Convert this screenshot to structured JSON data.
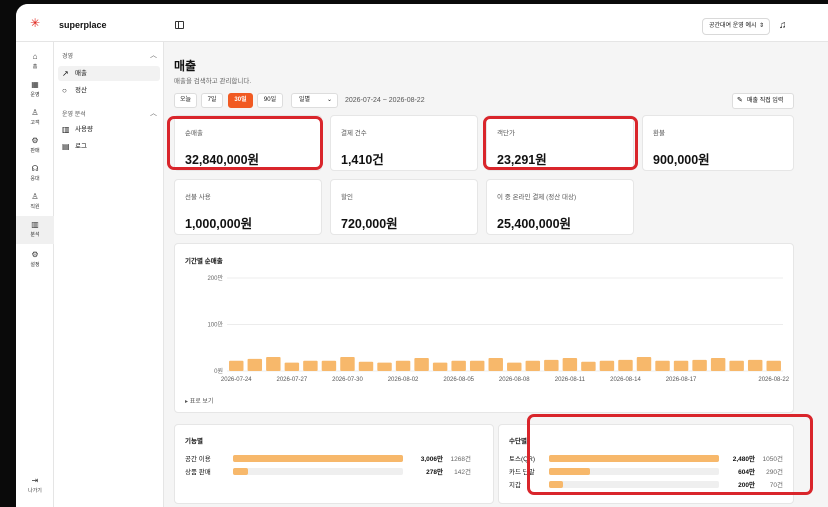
{
  "app": {
    "brand": "superplace",
    "store_select": "공간대여 운영 예시"
  },
  "rail": [
    {
      "icon": "home-icon",
      "glyph": "⌂",
      "label": "홈"
    },
    {
      "icon": "calendar-icon",
      "glyph": "▦",
      "label": "운영"
    },
    {
      "icon": "user-icon",
      "glyph": "♙",
      "label": "고객"
    },
    {
      "icon": "sales-icon",
      "glyph": "⚙",
      "label": "판매"
    },
    {
      "icon": "headset-icon",
      "glyph": "☊",
      "label": "응대"
    },
    {
      "icon": "staff-icon",
      "glyph": "♙",
      "label": "직원"
    },
    {
      "icon": "analytics-icon",
      "glyph": "▥",
      "label": "분석"
    },
    {
      "icon": "settings-icon",
      "glyph": "⚙",
      "label": "설정"
    },
    {
      "icon": "logout-icon",
      "glyph": "⇥",
      "label": "나가기"
    }
  ],
  "subnav": {
    "section1": "경영",
    "items1": [
      {
        "label": "매출",
        "glyph": "↗"
      },
      {
        "label": "정산",
        "glyph": "○"
      }
    ],
    "section2": "운영 분석",
    "items2": [
      {
        "label": "사용량",
        "glyph": "▥"
      },
      {
        "label": "로그",
        "glyph": "▤"
      }
    ]
  },
  "page": {
    "title": "매출",
    "subtitle": "매출을 검색하고 관리합니다."
  },
  "filters": {
    "ranges": [
      "오늘",
      "7일",
      "30일",
      "90일"
    ],
    "active_range": "30일",
    "period": "일별",
    "daterange": "2026-07-24 ~ 2026-08-22",
    "manual_button": "매출 직접 입력"
  },
  "kpis": [
    {
      "label": "순매출",
      "value": "32,840,000원"
    },
    {
      "label": "결제 건수",
      "value": "1,410건"
    },
    {
      "label": "객단가",
      "value": "23,291원"
    },
    {
      "label": "환불",
      "value": "900,000원"
    },
    {
      "label": "선불 사용",
      "value": "1,000,000원"
    },
    {
      "label": "할인",
      "value": "720,000원"
    },
    {
      "label": "이 중 온라인 결제 (정산 대상)",
      "value": "25,400,000원"
    }
  ],
  "chart_data": {
    "type": "bar",
    "title": "기간별 순매출",
    "y_ticks": [
      "200만",
      "100만",
      "0원"
    ],
    "ylim": [
      0,
      200
    ],
    "x": [
      "2026-07-24",
      "2026-07-25",
      "2026-07-26",
      "2026-07-27",
      "2026-07-28",
      "2026-07-29",
      "2026-07-30",
      "2026-07-31",
      "2026-08-01",
      "2026-08-02",
      "2026-08-03",
      "2026-08-04",
      "2026-08-05",
      "2026-08-06",
      "2026-08-07",
      "2026-08-08",
      "2026-08-09",
      "2026-08-10",
      "2026-08-11",
      "2026-08-12",
      "2026-08-13",
      "2026-08-14",
      "2026-08-15",
      "2026-08-16",
      "2026-08-17",
      "2026-08-18",
      "2026-08-19",
      "2026-08-20",
      "2026-08-21",
      "2026-08-22"
    ],
    "x_tick_labels": [
      "2026-07-24",
      "2026-07-27",
      "2026-07-30",
      "2026-08-02",
      "2026-08-05",
      "2026-08-08",
      "2026-08-11",
      "2026-08-14",
      "2026-08-17",
      "2026-08-22"
    ],
    "values": [
      22,
      26,
      30,
      18,
      22,
      22,
      30,
      20,
      18,
      22,
      28,
      18,
      22,
      22,
      28,
      18,
      22,
      24,
      28,
      20,
      22,
      24,
      30,
      22,
      22,
      24,
      28,
      22,
      24,
      22
    ],
    "legend_toggle": "표로 보기"
  },
  "by_feature": {
    "title": "기능별",
    "rows": [
      {
        "name": "공간 이용",
        "amount": "3,006만",
        "count": "1268건",
        "ratio": 1.0
      },
      {
        "name": "상품 판매",
        "amount": "278만",
        "count": "142건",
        "ratio": 0.09
      }
    ]
  },
  "by_method": {
    "title": "수단별",
    "rows": [
      {
        "name": "토스(QR)",
        "amount": "2,480만",
        "count": "1050건",
        "ratio": 1.0
      },
      {
        "name": "카드 단말",
        "amount": "604만",
        "count": "290건",
        "ratio": 0.24
      },
      {
        "name": "지갑",
        "amount": "200만",
        "count": "70건",
        "ratio": 0.08
      }
    ]
  },
  "colors": {
    "accent": "#f15a22",
    "bar": "#f7b86b",
    "highlight": "#d9252b"
  }
}
